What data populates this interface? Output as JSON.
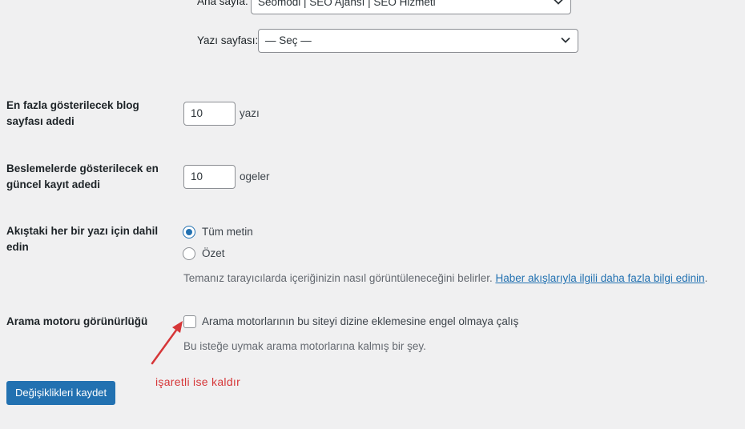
{
  "homepage": {
    "label": "Ana sayfa:",
    "value": "Seomodi | SEO Ajansı | SEO Hizmeti"
  },
  "posts_page": {
    "label": "Yazı sayfası:",
    "value": "— Seç —"
  },
  "blog_pages": {
    "label": "En fazla gösterilecek blog sayfası adedi",
    "value": "10",
    "unit": "yazı"
  },
  "feed_items": {
    "label": "Beslemelerde gösterilecek en güncel kayıt adedi",
    "value": "10",
    "unit": "ogeler"
  },
  "feed_content": {
    "label": "Akıştaki her bir yazı için dahil edin",
    "options": [
      "Tüm metin",
      "Özet"
    ],
    "selected": "Tüm metin",
    "description": "Temanız tarayıcılarda içeriğinizin nasıl görüntüleneceğini belirler.",
    "link_text": "Haber akışlarıyla ilgili daha fazla bilgi edinin",
    "period": "."
  },
  "search_visibility": {
    "label": "Arama motoru görünürlüğü",
    "checkbox_label": "Arama motorlarının bu siteyi dizine eklemesine engel olmaya çalış",
    "checked": false,
    "description": "Bu isteğe uymak arama motorlarına kalmış bir şey."
  },
  "annotation": {
    "text": "işaretli ise kaldır",
    "color": "#d63638"
  },
  "save_button": {
    "label": "Değişiklikleri kaydet"
  },
  "colors": {
    "accent": "#2271b1",
    "background": "#f0f0f1",
    "annotation": "#d63638"
  }
}
